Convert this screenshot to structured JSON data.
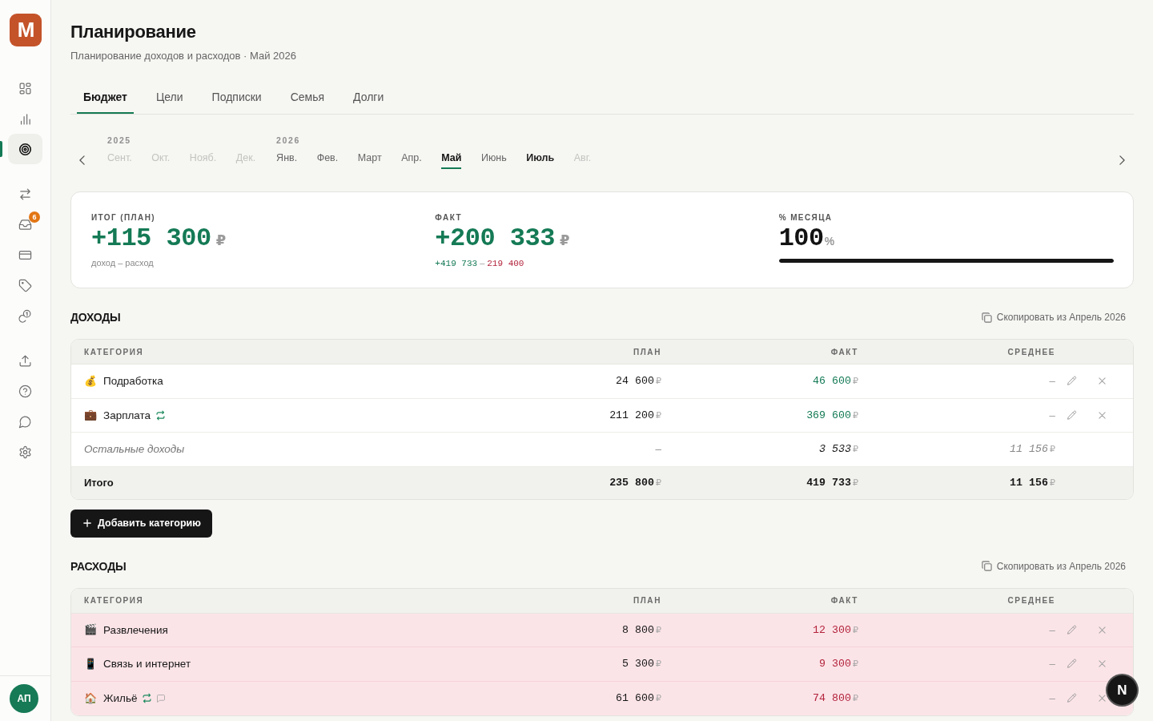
{
  "sidebar": {
    "logo": {
      "text": "M"
    },
    "nav_groups": [
      {
        "items": [
          {
            "selected": false
          },
          {
            "selected": false
          },
          {
            "selected": true
          }
        ]
      },
      {
        "items": [
          {
            "selected": false
          },
          {
            "selected": false,
            "badge": "6"
          },
          {
            "selected": false
          },
          {
            "selected": false
          },
          {
            "selected": false
          }
        ]
      },
      {
        "items": [
          {
            "selected": false
          },
          {
            "selected": false
          },
          {
            "selected": false
          },
          {
            "selected": false
          }
        ]
      }
    ],
    "avatar": {
      "initials": "АП"
    }
  },
  "page": {
    "title": "Планирование",
    "subtitle": "Планирование доходов и расходов · Май 2026"
  },
  "tabs": [
    {
      "label": "Бюджет",
      "selected": true
    },
    {
      "label": "Цели",
      "selected": false
    },
    {
      "label": "Подписки",
      "selected": false
    },
    {
      "label": "Семья",
      "selected": false
    },
    {
      "label": "Долги",
      "selected": false
    }
  ],
  "month_picker": {
    "years": [
      {
        "year": "2025",
        "months": [
          {
            "label": "Сент.",
            "selected": false,
            "kind": "inactive"
          },
          {
            "label": "Окт.",
            "selected": false,
            "kind": "inactive"
          },
          {
            "label": "Нояб.",
            "selected": false,
            "kind": "inactive"
          },
          {
            "label": "Дек.",
            "selected": false,
            "kind": "inactive"
          }
        ]
      },
      {
        "year": "2026",
        "months": [
          {
            "label": "Янв.",
            "selected": false,
            "kind": "active"
          },
          {
            "label": "Фев.",
            "selected": false,
            "kind": "active"
          },
          {
            "label": "Март",
            "selected": false,
            "kind": "active"
          },
          {
            "label": "Апр.",
            "selected": false,
            "kind": "active"
          },
          {
            "label": "Май",
            "selected": true,
            "kind": "active"
          },
          {
            "label": "Июнь",
            "selected": false,
            "kind": "active"
          },
          {
            "label": "Июль",
            "selected": false,
            "kind": "current"
          },
          {
            "label": "Авг.",
            "selected": false,
            "kind": "inactive"
          }
        ]
      }
    ]
  },
  "summary": {
    "items": [
      {
        "kind": "money",
        "label": "ИТОГ (ПЛАН)",
        "value": "+115 300",
        "unit": "₽",
        "note": "доход – расход"
      },
      {
        "kind": "money",
        "label": "ФАКТ",
        "value": "+200 333",
        "unit": "₽",
        "breakdown": {
          "income": "+419 733",
          "separator": "–",
          "expense": "219 400"
        }
      },
      {
        "kind": "progress",
        "label": "% МЕСЯЦА",
        "value": "100",
        "unit": "%",
        "level": 1
      }
    ]
  },
  "sections": [
    {
      "kind": "income",
      "title": "ДОХОДЫ",
      "copy_action": "Скопировать из Апрель 2026",
      "columns": [
        "КАТЕГОРИЯ",
        "ПЛАН",
        "ФАКТ",
        "СРЕДНЕЕ"
      ],
      "rows": [
        {
          "kind": "category",
          "emoji": "💰",
          "name": "Подработка",
          "recurring": false,
          "has_comment": false,
          "over_plan": true,
          "plan": {
            "amount": "24 600",
            "currency": "₽"
          },
          "fact": {
            "amount": "46 600",
            "currency": "₽"
          },
          "average": {
            "amount": "–"
          }
        },
        {
          "kind": "category",
          "emoji": "💼",
          "name": "Зарплата",
          "recurring": true,
          "has_comment": false,
          "over_plan": true,
          "plan": {
            "amount": "211 200",
            "currency": "₽"
          },
          "fact": {
            "amount": "369 600",
            "currency": "₽"
          },
          "average": {
            "amount": "–"
          }
        },
        {
          "kind": "other",
          "name": "Остальные доходы",
          "recurring": false,
          "has_comment": false,
          "over_plan": false,
          "plan": {
            "amount": "–"
          },
          "fact": {
            "amount": "3 533",
            "currency": "₽"
          },
          "average": {
            "amount": "11 156",
            "currency": "₽"
          }
        },
        {
          "kind": "total",
          "name": "Итого",
          "recurring": false,
          "has_comment": false,
          "over_plan": false,
          "plan": {
            "amount": "235 800",
            "currency": "₽"
          },
          "fact": {
            "amount": "419 733",
            "currency": "₽"
          },
          "average": {
            "amount": "11 156",
            "currency": "₽"
          }
        }
      ],
      "add_button": "Добавить категорию"
    },
    {
      "kind": "expense",
      "title": "РАСХОДЫ",
      "copy_action": "Скопировать из Апрель 2026",
      "columns": [
        "КАТЕГОРИЯ",
        "ПЛАН",
        "ФАКТ",
        "СРЕДНЕЕ"
      ],
      "rows": [
        {
          "kind": "category",
          "emoji": "🎬",
          "name": "Развлечения",
          "recurring": false,
          "has_comment": false,
          "over_plan": true,
          "plan": {
            "amount": "8 800",
            "currency": "₽"
          },
          "fact": {
            "amount": "12 300",
            "currency": "₽"
          },
          "average": {
            "amount": "–"
          }
        },
        {
          "kind": "category",
          "emoji": "📱",
          "name": "Связь и интернет",
          "recurring": false,
          "has_comment": false,
          "over_plan": true,
          "plan": {
            "amount": "5 300",
            "currency": "₽"
          },
          "fact": {
            "amount": "9 300",
            "currency": "₽"
          },
          "average": {
            "amount": "–"
          }
        },
        {
          "kind": "category",
          "emoji": "🏠",
          "name": "Жильё",
          "recurring": true,
          "has_comment": true,
          "over_plan": true,
          "plan": {
            "amount": "61 600",
            "currency": "₽"
          },
          "fact": {
            "amount": "74 800",
            "currency": "₽"
          },
          "average": {
            "amount": "–"
          }
        }
      ]
    }
  ],
  "dev_tools_button": {
    "label": "N"
  }
}
